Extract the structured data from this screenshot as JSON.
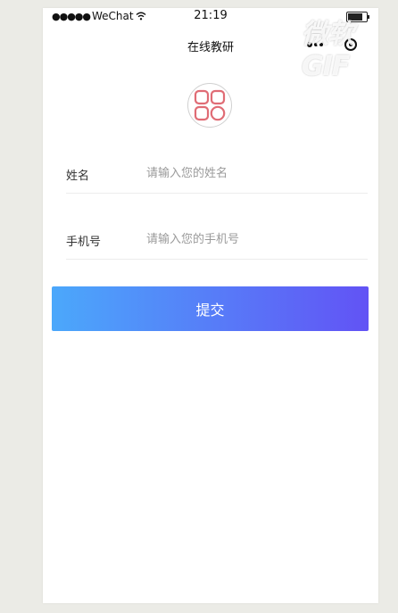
{
  "status_bar": {
    "signal_dots": "●●●●●",
    "carrier": "WeChat",
    "wifi_icon": "wifi-icon",
    "time": "21:19",
    "battery_level": 0.9
  },
  "nav": {
    "title": "在线教研",
    "more_icon": "more-dots-icon",
    "close_icon": "target-close-icon"
  },
  "watermark": "微软GIF",
  "logo": {
    "icon": "grid-apps-icon",
    "color": "#e06c75"
  },
  "form": {
    "name_label": "姓名",
    "name_placeholder": "请输入您的姓名",
    "name_value": "",
    "phone_label": "手机号",
    "phone_placeholder": "请输入您的手机号",
    "phone_value": ""
  },
  "submit_label": "提交",
  "colors": {
    "gradient_start": "#4ba8fb",
    "gradient_end": "#6253f5",
    "background": "#ebebe6"
  }
}
